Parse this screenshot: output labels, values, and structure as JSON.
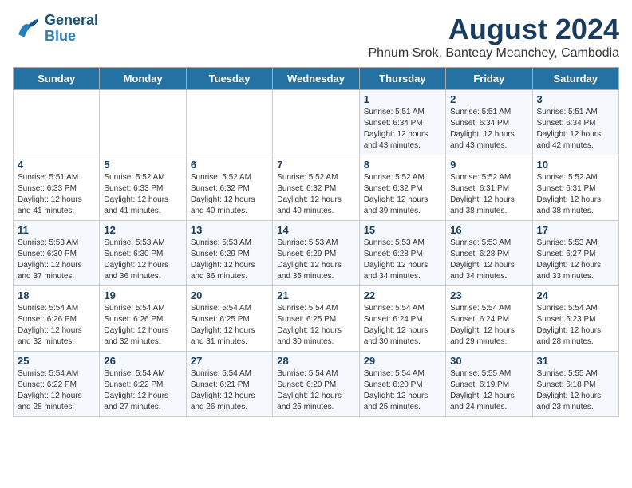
{
  "header": {
    "logo_line1": "General",
    "logo_line2": "Blue",
    "month_year": "August 2024",
    "location": "Phnum Srok, Banteay Meanchey, Cambodia"
  },
  "days_of_week": [
    "Sunday",
    "Monday",
    "Tuesday",
    "Wednesday",
    "Thursday",
    "Friday",
    "Saturday"
  ],
  "weeks": [
    [
      {
        "day": "",
        "info": ""
      },
      {
        "day": "",
        "info": ""
      },
      {
        "day": "",
        "info": ""
      },
      {
        "day": "",
        "info": ""
      },
      {
        "day": "1",
        "info": "Sunrise: 5:51 AM\nSunset: 6:34 PM\nDaylight: 12 hours\nand 43 minutes."
      },
      {
        "day": "2",
        "info": "Sunrise: 5:51 AM\nSunset: 6:34 PM\nDaylight: 12 hours\nand 43 minutes."
      },
      {
        "day": "3",
        "info": "Sunrise: 5:51 AM\nSunset: 6:34 PM\nDaylight: 12 hours\nand 42 minutes."
      }
    ],
    [
      {
        "day": "4",
        "info": "Sunrise: 5:51 AM\nSunset: 6:33 PM\nDaylight: 12 hours\nand 41 minutes."
      },
      {
        "day": "5",
        "info": "Sunrise: 5:52 AM\nSunset: 6:33 PM\nDaylight: 12 hours\nand 41 minutes."
      },
      {
        "day": "6",
        "info": "Sunrise: 5:52 AM\nSunset: 6:32 PM\nDaylight: 12 hours\nand 40 minutes."
      },
      {
        "day": "7",
        "info": "Sunrise: 5:52 AM\nSunset: 6:32 PM\nDaylight: 12 hours\nand 40 minutes."
      },
      {
        "day": "8",
        "info": "Sunrise: 5:52 AM\nSunset: 6:32 PM\nDaylight: 12 hours\nand 39 minutes."
      },
      {
        "day": "9",
        "info": "Sunrise: 5:52 AM\nSunset: 6:31 PM\nDaylight: 12 hours\nand 38 minutes."
      },
      {
        "day": "10",
        "info": "Sunrise: 5:52 AM\nSunset: 6:31 PM\nDaylight: 12 hours\nand 38 minutes."
      }
    ],
    [
      {
        "day": "11",
        "info": "Sunrise: 5:53 AM\nSunset: 6:30 PM\nDaylight: 12 hours\nand 37 minutes."
      },
      {
        "day": "12",
        "info": "Sunrise: 5:53 AM\nSunset: 6:30 PM\nDaylight: 12 hours\nand 36 minutes."
      },
      {
        "day": "13",
        "info": "Sunrise: 5:53 AM\nSunset: 6:29 PM\nDaylight: 12 hours\nand 36 minutes."
      },
      {
        "day": "14",
        "info": "Sunrise: 5:53 AM\nSunset: 6:29 PM\nDaylight: 12 hours\nand 35 minutes."
      },
      {
        "day": "15",
        "info": "Sunrise: 5:53 AM\nSunset: 6:28 PM\nDaylight: 12 hours\nand 34 minutes."
      },
      {
        "day": "16",
        "info": "Sunrise: 5:53 AM\nSunset: 6:28 PM\nDaylight: 12 hours\nand 34 minutes."
      },
      {
        "day": "17",
        "info": "Sunrise: 5:53 AM\nSunset: 6:27 PM\nDaylight: 12 hours\nand 33 minutes."
      }
    ],
    [
      {
        "day": "18",
        "info": "Sunrise: 5:54 AM\nSunset: 6:26 PM\nDaylight: 12 hours\nand 32 minutes."
      },
      {
        "day": "19",
        "info": "Sunrise: 5:54 AM\nSunset: 6:26 PM\nDaylight: 12 hours\nand 32 minutes."
      },
      {
        "day": "20",
        "info": "Sunrise: 5:54 AM\nSunset: 6:25 PM\nDaylight: 12 hours\nand 31 minutes."
      },
      {
        "day": "21",
        "info": "Sunrise: 5:54 AM\nSunset: 6:25 PM\nDaylight: 12 hours\nand 30 minutes."
      },
      {
        "day": "22",
        "info": "Sunrise: 5:54 AM\nSunset: 6:24 PM\nDaylight: 12 hours\nand 30 minutes."
      },
      {
        "day": "23",
        "info": "Sunrise: 5:54 AM\nSunset: 6:24 PM\nDaylight: 12 hours\nand 29 minutes."
      },
      {
        "day": "24",
        "info": "Sunrise: 5:54 AM\nSunset: 6:23 PM\nDaylight: 12 hours\nand 28 minutes."
      }
    ],
    [
      {
        "day": "25",
        "info": "Sunrise: 5:54 AM\nSunset: 6:22 PM\nDaylight: 12 hours\nand 28 minutes."
      },
      {
        "day": "26",
        "info": "Sunrise: 5:54 AM\nSunset: 6:22 PM\nDaylight: 12 hours\nand 27 minutes."
      },
      {
        "day": "27",
        "info": "Sunrise: 5:54 AM\nSunset: 6:21 PM\nDaylight: 12 hours\nand 26 minutes."
      },
      {
        "day": "28",
        "info": "Sunrise: 5:54 AM\nSunset: 6:20 PM\nDaylight: 12 hours\nand 25 minutes."
      },
      {
        "day": "29",
        "info": "Sunrise: 5:54 AM\nSunset: 6:20 PM\nDaylight: 12 hours\nand 25 minutes."
      },
      {
        "day": "30",
        "info": "Sunrise: 5:55 AM\nSunset: 6:19 PM\nDaylight: 12 hours\nand 24 minutes."
      },
      {
        "day": "31",
        "info": "Sunrise: 5:55 AM\nSunset: 6:18 PM\nDaylight: 12 hours\nand 23 minutes."
      }
    ]
  ]
}
